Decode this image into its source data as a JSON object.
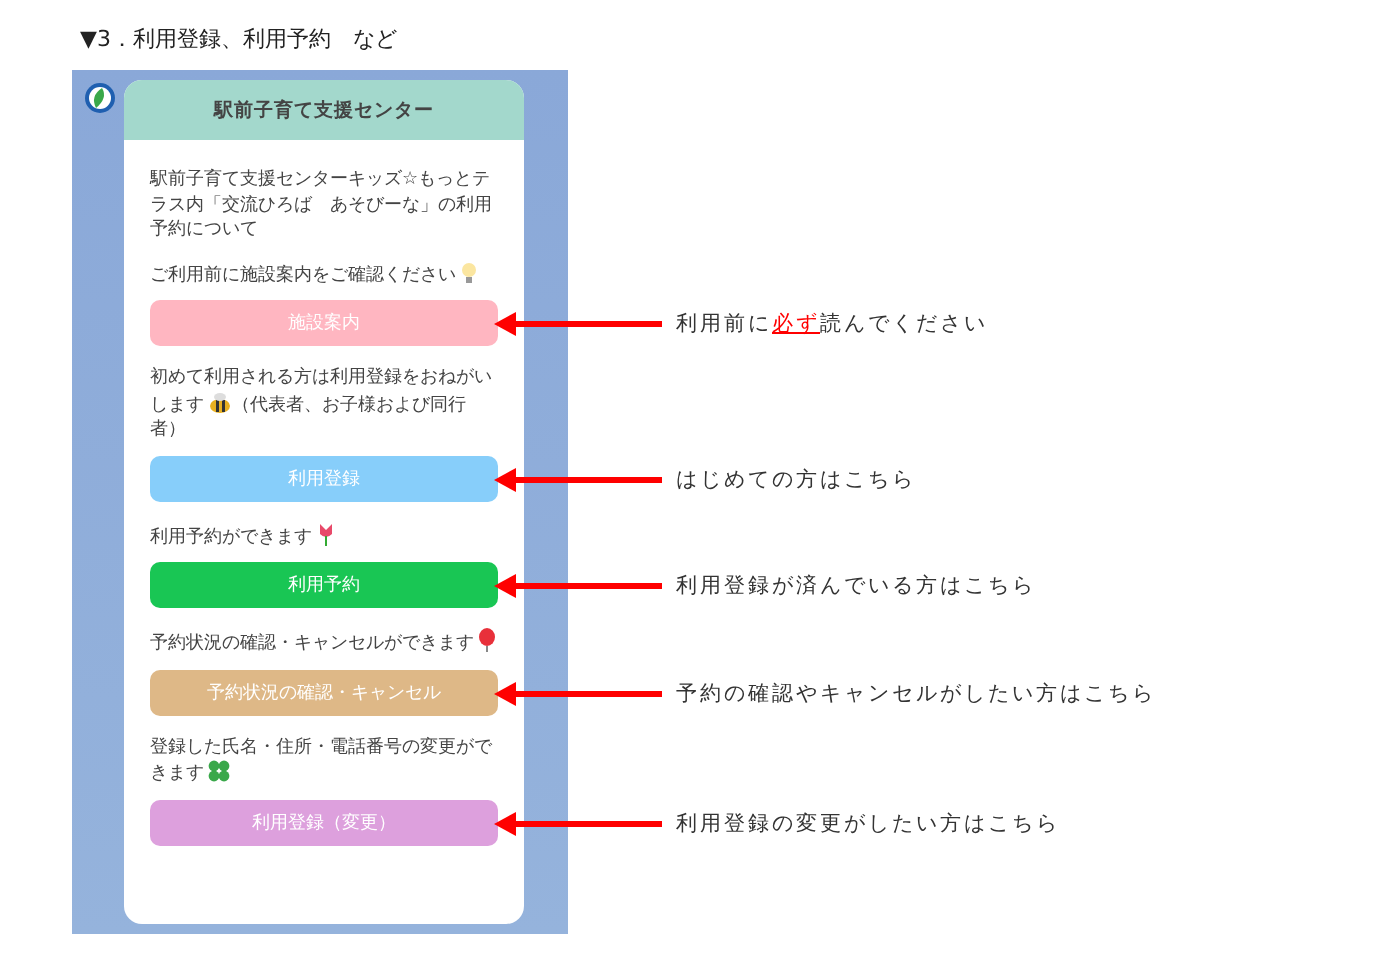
{
  "heading": "▼3．利用登録、利用予約　など",
  "card": {
    "title": "駅前子育て支援センター",
    "intro": "駅前子育て支援センターキッズ☆もっとテラス内「交流ひろば　あそびーな」の利用予約について"
  },
  "sections": [
    {
      "text": "ご利用前に施設案内をご確認ください",
      "kind": "lightbulb",
      "button": "施設案内",
      "color": "#ffb6c1",
      "note": "利用前に**必ず**読んでください"
    },
    {
      "text": "初めて利用される方は利用登録をおねがいします",
      "kind": "bee",
      "after": "（代表者、お子様および同行者）",
      "button": "利用登録",
      "color": "#87cefa",
      "note": "はじめての方はこちら"
    },
    {
      "text": "利用予約ができます",
      "kind": "tulip",
      "button": "利用予約",
      "color": "#19c654",
      "note": "利用登録が済んでいる方はこちら"
    },
    {
      "text": "予約状況の確認・キャンセルができます",
      "kind": "balloon",
      "button": "予約状況の確認・キャンセル",
      "color": "#deb887",
      "note": "予約の確認やキャンセルがしたい方はこちら"
    },
    {
      "text": "登録した氏名・住所・電話番号の変更ができます",
      "kind": "clover",
      "button": "利用登録（変更）",
      "color": "#dda0dd",
      "note": "利用登録の変更がしたい方はこちら"
    }
  ]
}
